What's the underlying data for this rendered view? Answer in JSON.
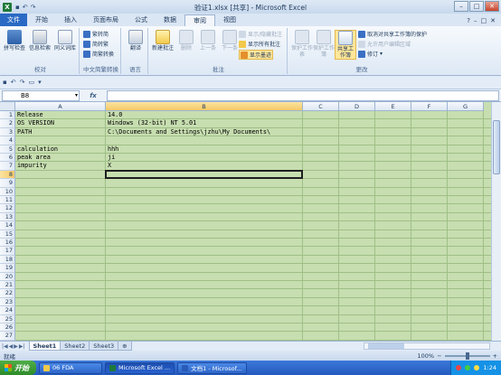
{
  "window": {
    "title": "验证1.xlsx [共享] - Microsoft Excel",
    "minimize": "–",
    "maximize": "□",
    "close": "✕"
  },
  "ribbon_tabs": {
    "file": "文件",
    "items": [
      "开始",
      "插入",
      "页面布局",
      "公式",
      "数据",
      "审阅",
      "视图"
    ],
    "active_index": 5,
    "right_icons": [
      "?",
      "–",
      "□",
      "✕"
    ]
  },
  "ribbon": {
    "proofing": {
      "label": "校对",
      "buttons": [
        "拼写检查",
        "信息检索",
        "同义词库"
      ]
    },
    "chinese": {
      "label": "中文简繁转换",
      "items": [
        "繁转简",
        "简转繁",
        "简繁转换"
      ]
    },
    "language": {
      "label": "语言",
      "buttons": [
        "翻译"
      ]
    },
    "comments": {
      "label": "批注",
      "buttons": [
        "新建批注",
        "删除",
        "上一条",
        "下一条"
      ],
      "items": [
        "显示/隐藏批注",
        "显示所有批注",
        "显示墨迹"
      ]
    },
    "changes": {
      "label": "更改",
      "buttons": [
        "保护工作表",
        "保护工作簿",
        "共享工作簿"
      ],
      "items": [
        "取消对共享工作簿的保护",
        "允许用户编辑区域",
        "修订"
      ]
    }
  },
  "namebox": {
    "value": "B8"
  },
  "formula_bar": {
    "fx": "fx",
    "value": ""
  },
  "sheet": {
    "columns": [
      "A",
      "B",
      "C",
      "D",
      "E",
      "F",
      "G"
    ],
    "selected_column": "B",
    "selected_row": 8,
    "row_numbers": [
      "1",
      "2",
      "3",
      "4",
      "5",
      "6",
      "7",
      "8",
      "9",
      "10",
      "11",
      "12",
      "13",
      "14",
      "15",
      "16",
      "17",
      "18",
      "19",
      "20",
      "21",
      "22",
      "23",
      "24",
      "25",
      "26",
      "27"
    ],
    "cells": [
      {
        "row": 1,
        "a": "Release",
        "b": "14.0"
      },
      {
        "row": 2,
        "a": "OS VERSION",
        "b": "Windows (32-bit) NT 5.01"
      },
      {
        "row": 3,
        "a": "PATH",
        "b": "C:\\Documents and Settings\\jzhu\\My Documents\\"
      },
      {
        "row": 5,
        "a": "calculation",
        "b": "hhh"
      },
      {
        "row": 6,
        "a": "peak area",
        "b": "ji"
      },
      {
        "row": 7,
        "a": "impurity",
        "b": "X"
      }
    ]
  },
  "sheet_tabs": [
    "Sheet1",
    "Sheet2",
    "Sheet3"
  ],
  "status": {
    "text": "就绪",
    "zoom": "100%",
    "zoom_level_percent": 100
  },
  "taskbar": {
    "start": "开始",
    "tasks": [
      "06 FDA",
      "Microsoft Excel ...",
      "文档1 - Microsof..."
    ],
    "active_task_index": 1,
    "clock": "1:24"
  },
  "colors": {
    "cell_background": "#c7deb0",
    "accent": "#2a6ac4",
    "taskbar": "#245ac0"
  }
}
